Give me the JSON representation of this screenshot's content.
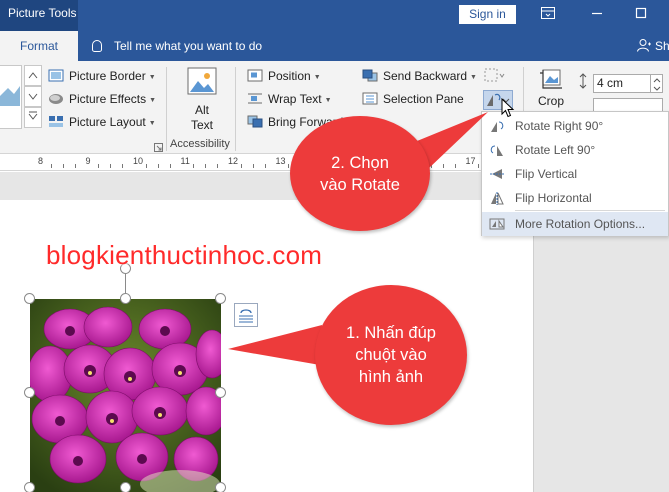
{
  "titlebar": {
    "context_tab": "Picture Tools",
    "signin": "Sign in"
  },
  "tabs": {
    "format": "Format",
    "tellme": "Tell me what you want to do",
    "share": "Share"
  },
  "ribbon": {
    "picture_border": "Picture Border",
    "picture_effects": "Picture Effects",
    "picture_layout": "Picture Layout",
    "alt_text_1": "Alt",
    "alt_text_2": "Text",
    "accessibility": "Accessibility",
    "position": "Position",
    "wrap_text": "Wrap Text",
    "bring_forward": "Bring Forward",
    "send_backward": "Send Backward",
    "selection_pane": "Selection Pane",
    "crop": "Crop",
    "height_value": "4 cm"
  },
  "ruler": {
    "labels": [
      "8",
      "9",
      "10",
      "11",
      "12",
      "13",
      "14",
      "15",
      "16",
      "17"
    ]
  },
  "rotate_menu": {
    "items": [
      {
        "label": "Rotate Right 90°",
        "icon": "rotate-right-icon"
      },
      {
        "label": "Rotate Left 90°",
        "icon": "rotate-left-icon"
      },
      {
        "label": "Flip Vertical",
        "icon": "flip-vertical-icon"
      },
      {
        "label": "Flip Horizontal",
        "icon": "flip-horizontal-icon"
      },
      {
        "label": "More Rotation Options...",
        "icon": "more-rotation-icon"
      }
    ]
  },
  "watermark": "blogkienthuctinhoc.com",
  "callouts": {
    "step2": [
      "2. Chọn",
      "vào Rotate"
    ],
    "step1": [
      "1. Nhấn đúp",
      "chuột vào",
      "hình ảnh"
    ]
  },
  "colors": {
    "accent": "#2b579a",
    "callout": "#ed3b3b",
    "watermark": "#ff2a2a",
    "menu_highlight": "#dfe7f3"
  }
}
